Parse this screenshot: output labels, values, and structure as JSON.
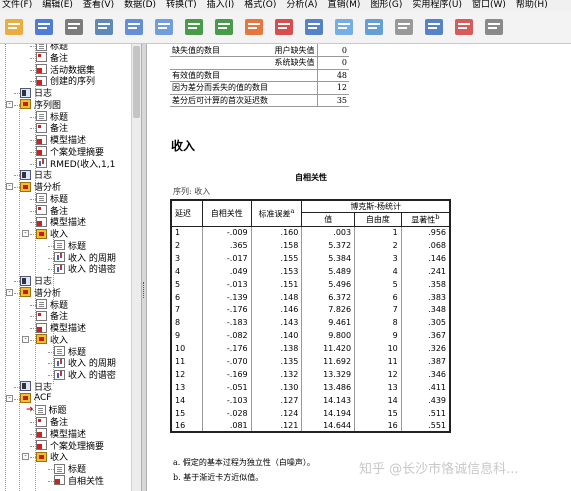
{
  "menu": [
    "文件(F)",
    "编辑(E)",
    "查看(V)",
    "数据(D)",
    "转换(T)",
    "插入(I)",
    "格式(O)",
    "分析(A)",
    "直销(M)",
    "图形(G)",
    "实用程序(U)",
    "窗口(W)",
    "帮助(H)"
  ],
  "toolbar_icons": [
    "open-folder-icon",
    "save-icon",
    "print-icon",
    "print-preview-icon",
    "export-icon",
    "recall-dialog-icon",
    "undo-icon",
    "redo-icon",
    "goto-data-icon",
    "goto-case-icon",
    "variables-icon",
    "designate-window-icon",
    "show-all-icon",
    "hide-icon",
    "promote-icon",
    "demote-icon",
    "collapse-icon"
  ],
  "tree": [
    {
      "label": "标题",
      "icon": "doc"
    },
    {
      "label": "备注",
      "icon": "note"
    },
    {
      "label": "活动数据集",
      "icon": "red"
    },
    {
      "label": "创建的序列",
      "icon": "red"
    },
    {
      "label": "日志",
      "icon": "log"
    },
    {
      "label": "序列图",
      "icon": "book"
    },
    {
      "label": "标题",
      "icon": "doc"
    },
    {
      "label": "备注",
      "icon": "note"
    },
    {
      "label": "模型描述",
      "icon": "red"
    },
    {
      "label": "个案处理摘要",
      "icon": "red"
    },
    {
      "label": "RMED(收入,1,1",
      "icon": "chart"
    },
    {
      "label": "日志",
      "icon": "log"
    },
    {
      "label": "谱分析",
      "icon": "book"
    },
    {
      "label": "标题",
      "icon": "doc"
    },
    {
      "label": "备注",
      "icon": "note"
    },
    {
      "label": "模型描述",
      "icon": "red"
    },
    {
      "label": "收入",
      "icon": "book"
    },
    {
      "label": "标题",
      "icon": "doc"
    },
    {
      "label": "收入 的周期",
      "icon": "chart"
    },
    {
      "label": "收入 的谱密",
      "icon": "chart"
    },
    {
      "label": "日志",
      "icon": "log"
    },
    {
      "label": "谱分析",
      "icon": "book"
    },
    {
      "label": "标题",
      "icon": "doc"
    },
    {
      "label": "备注",
      "icon": "note"
    },
    {
      "label": "模型描述",
      "icon": "red"
    },
    {
      "label": "收入",
      "icon": "book"
    },
    {
      "label": "标题",
      "icon": "doc"
    },
    {
      "label": "收入 的周期",
      "icon": "chart"
    },
    {
      "label": "收入 的谱密",
      "icon": "chart"
    },
    {
      "label": "日志",
      "icon": "log"
    },
    {
      "label": "ACF",
      "icon": "book"
    },
    {
      "label": "标题",
      "icon": "doc"
    },
    {
      "label": "备注",
      "icon": "note"
    },
    {
      "label": "模型描述",
      "icon": "red"
    },
    {
      "label": "个案处理摘要",
      "icon": "red"
    },
    {
      "label": "收入",
      "icon": "book"
    },
    {
      "label": "标题",
      "icon": "doc"
    },
    {
      "label": "自相关性",
      "icon": "red"
    }
  ],
  "summary_table": {
    "rows": [
      {
        "label": "缺失值的数目",
        "sub": "用户缺失值",
        "value": "0"
      },
      {
        "label": "",
        "sub": "系统缺失值",
        "value": "0"
      },
      {
        "label": "有效值的数目",
        "sub": "",
        "value": "48"
      },
      {
        "label": "因为差分而丢失的值的数目",
        "sub": "",
        "value": "12"
      },
      {
        "label": "差分后可计算的首次延迟数",
        "sub": "",
        "value": "35"
      }
    ]
  },
  "section_title": "收入",
  "acf_table": {
    "title": "自相关性",
    "series_label": "序列:   收入",
    "col_lag": "延迟",
    "col_acf": "自相关性",
    "col_se": "标准误差",
    "se_sup": "a",
    "group_header": "博克斯-杨统计",
    "col_value": "值",
    "col_df": "自由度",
    "col_sig": "显著性",
    "sig_sup": "b",
    "rows": [
      [
        "1",
        "-.009",
        ".160",
        ".003",
        "1",
        ".956"
      ],
      [
        "2",
        ".365",
        ".158",
        "5.372",
        "2",
        ".068"
      ],
      [
        "3",
        "-.017",
        ".155",
        "5.384",
        "3",
        ".146"
      ],
      [
        "4",
        ".049",
        ".153",
        "5.489",
        "4",
        ".241"
      ],
      [
        "5",
        "-.013",
        ".151",
        "5.496",
        "5",
        ".358"
      ],
      [
        "6",
        "-.139",
        ".148",
        "6.372",
        "6",
        ".383"
      ],
      [
        "7",
        "-.176",
        ".146",
        "7.826",
        "7",
        ".348"
      ],
      [
        "8",
        "-.183",
        ".143",
        "9.461",
        "8",
        ".305"
      ],
      [
        "9",
        "-.082",
        ".140",
        "9.800",
        "9",
        ".367"
      ],
      [
        "10",
        "-.176",
        ".138",
        "11.420",
        "10",
        ".326"
      ],
      [
        "11",
        "-.070",
        ".135",
        "11.692",
        "11",
        ".387"
      ],
      [
        "12",
        "-.169",
        ".132",
        "13.329",
        "12",
        ".346"
      ],
      [
        "13",
        "-.051",
        ".130",
        "13.486",
        "13",
        ".411"
      ],
      [
        "14",
        "-.103",
        ".127",
        "14.143",
        "14",
        ".439"
      ],
      [
        "15",
        "-.028",
        ".124",
        "14.194",
        "15",
        ".511"
      ],
      [
        "16",
        ".081",
        ".121",
        "14.644",
        "16",
        ".551"
      ]
    ],
    "footnotes": [
      "a. 假定的基本过程为独立性（白噪声）。",
      "b. 基于渐近卡方近似值。"
    ]
  },
  "watermark": "知乎 @长沙市恪诚信息科..."
}
